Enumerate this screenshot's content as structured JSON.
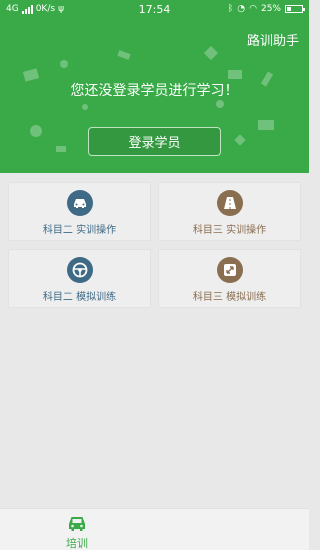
{
  "status_bar": {
    "network": "4G",
    "speed": "0K/s",
    "time": "17:54",
    "battery": "25%"
  },
  "header": {
    "helper_link": "路训助手",
    "prompt": "您还没登录学员进行学习！",
    "login_button": "登录学员"
  },
  "modules": [
    {
      "label": "科目二  实训操作",
      "icon": "car-icon",
      "color": "#3f6a86"
    },
    {
      "label": "科目三  实训操作",
      "icon": "road-icon",
      "color": "#8a6e50"
    },
    {
      "label": "科目二  模拟训练",
      "icon": "steering-wheel-icon",
      "color": "#3f6a86"
    },
    {
      "label": "科目三  模拟训练",
      "icon": "expand-arrows-icon",
      "color": "#8a6e50"
    }
  ],
  "bottom_nav": {
    "tabs": [
      {
        "label": "培训",
        "icon": "car-icon",
        "active": true
      }
    ]
  },
  "colors": {
    "brand_green": "#3aaa48",
    "accent_blue": "#3f6a86",
    "accent_brown": "#8a6e50"
  }
}
